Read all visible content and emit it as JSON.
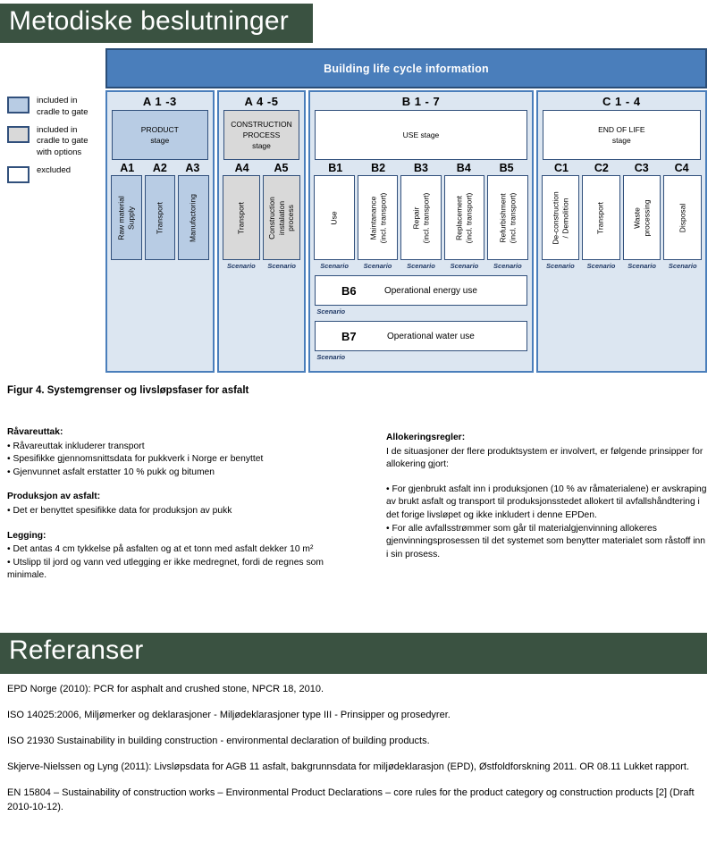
{
  "sections": {
    "methods_title": "Metodiske beslutninger",
    "references_title": "Referanser"
  },
  "legend": {
    "items": [
      {
        "label": "included in\ncradle to gate",
        "color": "#b8cce4",
        "swatch": "blue"
      },
      {
        "label": "included in\ncradle to gate\nwith options",
        "color": "#d9d9d9",
        "swatch": "gray"
      },
      {
        "label": "excluded",
        "color": "#ffffff",
        "swatch": "white"
      }
    ]
  },
  "diagram": {
    "header": "Building life cycle information",
    "panels": [
      {
        "group_code": "A 1 -3",
        "stage_label": "PRODUCT\nstage",
        "stage_fill": "blue",
        "codes": [
          "A1",
          "A2",
          "A3"
        ],
        "modules": [
          {
            "label": "Raw material\nSupply",
            "fill": "blue"
          },
          {
            "label": "Transport",
            "fill": "blue"
          },
          {
            "label": "Manufactoring",
            "fill": "blue"
          }
        ],
        "scenarios": [
          "",
          "",
          ""
        ]
      },
      {
        "group_code": "A 4 -5",
        "stage_label": "CONSTRUCTION\nPROCESS\nstage",
        "stage_fill": "gray",
        "codes": [
          "A4",
          "A5"
        ],
        "modules": [
          {
            "label": "Transport",
            "fill": "gray"
          },
          {
            "label": "Construction\ninstalation\nprocess",
            "fill": "gray"
          }
        ],
        "scenarios": [
          "Scenario",
          "Scenario"
        ]
      },
      {
        "group_code": "B 1 - 7",
        "stage_label": "USE stage",
        "stage_fill": "white",
        "codes": [
          "B1",
          "B2",
          "B3",
          "B4",
          "B5"
        ],
        "modules": [
          {
            "label": "Use",
            "fill": "white"
          },
          {
            "label": "Maintanance\n(incl. transport)",
            "fill": "white"
          },
          {
            "label": "Repair\n(incl. transport)",
            "fill": "white"
          },
          {
            "label": "Replacement\n(incl. transport)",
            "fill": "white"
          },
          {
            "label": "Refurbishment\n(incl. transport)",
            "fill": "white"
          }
        ],
        "scenarios": [
          "Scenario",
          "Scenario",
          "Scenario",
          "Scenario",
          "Scenario"
        ],
        "wide_rows": [
          {
            "code": "B6",
            "label": "Operational energy use",
            "scenario": "Scenario"
          },
          {
            "code": "B7",
            "label": "Operational water use",
            "scenario": "Scenario"
          }
        ]
      },
      {
        "group_code": "C 1 - 4",
        "stage_label": "END OF LIFE\nstage",
        "stage_fill": "white",
        "codes": [
          "C1",
          "C2",
          "C3",
          "C4"
        ],
        "modules": [
          {
            "label": "De-construction\n/ Demolition",
            "fill": "white"
          },
          {
            "label": "Transport",
            "fill": "white"
          },
          {
            "label": "Waste\nprocessing",
            "fill": "white"
          },
          {
            "label": "Disposal",
            "fill": "white"
          }
        ],
        "scenarios": [
          "Scenario",
          "Scenario",
          "Scenario",
          "Scenario"
        ]
      }
    ]
  },
  "figure_caption": "Figur 4. Systemgrenser og livsløpsfaser for asfalt",
  "left_column": {
    "block1_head": "Råvareuttak:",
    "block1_lines": [
      "• Råvareuttak inkluderer transport",
      "• Spesifikke gjennomsnittsdata for pukkverk i Norge er benyttet",
      "• Gjenvunnet asfalt erstatter 10 % pukk og bitumen"
    ],
    "block2_head": "Produksjon av asfalt:",
    "block2_lines": [
      "• Det er benyttet spesifikke data for produksjon av pukk"
    ],
    "block3_head": "Legging:",
    "block3_lines": [
      "• Det antas 4 cm tykkelse på asfalten og at et tonn med asfalt dekker 10 m²",
      "• Utslipp til jord og vann ved utlegging er ikke medregnet, fordi de regnes som minimale."
    ]
  },
  "right_column": {
    "head": "Allokeringsregler:",
    "intro": "I de situasjoner der flere produktsystem er involvert, er følgende prinsipper for allokering gjort:",
    "bullets": [
      "• For gjenbrukt asfalt inn i produksjonen (10 % av råmaterialene) er avskraping av brukt asfalt og transport til produksjonsstedet allokert til avfallshåndtering i det forige livsløpet og ikke inkludert i denne EPDen.",
      "• For alle avfallsstrømmer som går til materialgjenvinning allokeres gjenvinningsprosessen til det systemet som benytter materialet som råstoff inn i sin prosess."
    ]
  },
  "references": [
    "EPD Norge (2010): PCR for asphalt and crushed stone, NPCR 18, 2010.",
    "ISO 14025:2006, Miljømerker og deklarasjoner - Miljødeklarasjoner type III - Prinsipper og prosedyrer.",
    "ISO  21930  Sustainability in building construction - environmental declaration of building products.",
    "Skjerve-Nielssen og Lyng (2011): Livsløpsdata for AGB 11 asfalt, bakgrunnsdata for miljødeklarasjon (EPD), Østfoldforskning 2011. OR 08.11 Lukket rapport.",
    "EN 15804 – Sustainability of construction works – Environmental Product Declarations – core rules for the product category og construction products [2] (Draft 2010-10-12)."
  ],
  "colors": {
    "banner_green": "#3a5241",
    "header_blue": "#4a7ebb",
    "panel_bg": "#dce6f1",
    "module_blue": "#b8cce4",
    "module_gray": "#d9d9d9",
    "border_dark": "#31507c"
  }
}
